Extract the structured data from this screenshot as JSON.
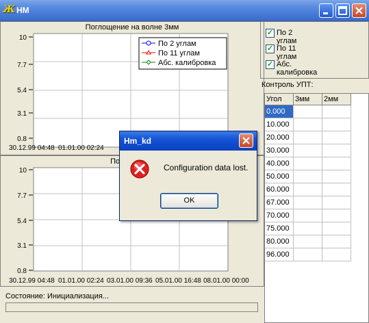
{
  "window": {
    "title": "НМ",
    "icon": "app-icon"
  },
  "chart_top": {
    "title": "Поглощение на волне 3мм",
    "yticks": [
      "10",
      "7.7",
      "5.4",
      "3.1",
      "0.8"
    ],
    "xticks": [
      "30.12.99 04:48",
      "01.01.00 02:24"
    ],
    "legend": [
      "По 2 углам",
      "По 11 углам",
      "Абс. калибровка"
    ]
  },
  "chart_bottom": {
    "title": "Поглощение",
    "yticks": [
      "10",
      "7.7",
      "5.4",
      "3.1",
      "0.8"
    ],
    "xticks": [
      "30.12.99 04:48",
      "01.01.00 02:24",
      "03.01.00 09:36",
      "05.01.00 16:48",
      "08.01.00 00:00"
    ]
  },
  "chart_data": [
    {
      "type": "line",
      "title": "Поглощение на волне 3мм",
      "xlabel": "",
      "ylabel": "",
      "ylim": [
        0.8,
        10
      ],
      "yticks": [
        10,
        7.7,
        5.4,
        3.1,
        0.8
      ],
      "xticks": [
        "30.12.99 04:48",
        "01.01.00 02:24"
      ],
      "series": [
        {
          "name": "По 2 углам",
          "color": "#0000FF",
          "values": []
        },
        {
          "name": "По 11 углам",
          "color": "#FF0000",
          "values": []
        },
        {
          "name": "Абс. калибровка",
          "color": "#008000",
          "values": []
        }
      ],
      "grid": true,
      "legend_position": "top-right"
    },
    {
      "type": "line",
      "title": "Поглощение",
      "ylim": [
        0.8,
        10
      ],
      "yticks": [
        10,
        7.7,
        5.4,
        3.1,
        0.8
      ],
      "xticks": [
        "30.12.99 04:48",
        "01.01.00 02:24",
        "03.01.00 09:36",
        "05.01.00 16:48",
        "08.01.00 00:00"
      ],
      "series": [],
      "grid": true
    }
  ],
  "options": {
    "items": [
      {
        "label": "По 2 углам",
        "checked": true
      },
      {
        "label": "По 11 углам",
        "checked": true
      },
      {
        "label": "Абс. калибровка",
        "checked": true
      }
    ]
  },
  "upt": {
    "label": "Контроль УПТ:",
    "headers": [
      "Угол",
      "3мм",
      "2мм"
    ],
    "rows": [
      "0.000",
      "10.000",
      "20.000",
      "30.000",
      "40.000",
      "50.000",
      "60.000",
      "67.000",
      "70.000",
      "75.000",
      "80.000",
      "96.000"
    ]
  },
  "status": {
    "label": "Состояние:",
    "value": "Инициализация..."
  },
  "dialog": {
    "title": "Hm_kd",
    "message": "Configuration data lost.",
    "ok_label": "OK",
    "icon": "error-icon"
  }
}
